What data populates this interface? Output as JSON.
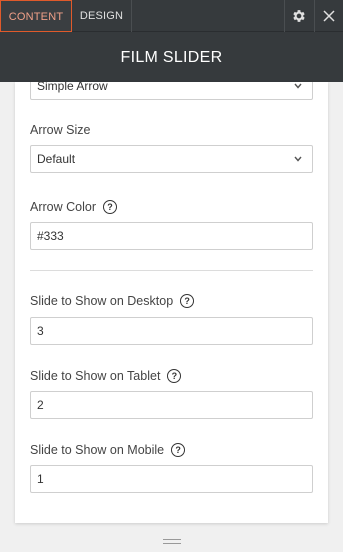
{
  "tabs": {
    "content": "CONTENT",
    "design": "DESIGN"
  },
  "header": {
    "title": "FILM SLIDER"
  },
  "fields": {
    "arrow_style": {
      "value": "Simple Arrow"
    },
    "arrow_size": {
      "label": "Arrow Size",
      "value": "Default"
    },
    "arrow_color": {
      "label": "Arrow Color",
      "value": "#333"
    },
    "slides_desktop": {
      "label": "Slide to Show on Desktop",
      "value": "3"
    },
    "slides_tablet": {
      "label": "Slide to Show on Tablet",
      "value": "2"
    },
    "slides_mobile": {
      "label": "Slide to Show on Mobile",
      "value": "1"
    }
  },
  "icons": {
    "help": "?",
    "gear": "gear-icon",
    "close": "close-icon",
    "chevron": "chevron-down-icon"
  },
  "colors": {
    "header_bg": "#363a3d",
    "accent": "#e05a2b",
    "panel_bg": "#ffffff",
    "page_bg": "#f0f0f0"
  }
}
